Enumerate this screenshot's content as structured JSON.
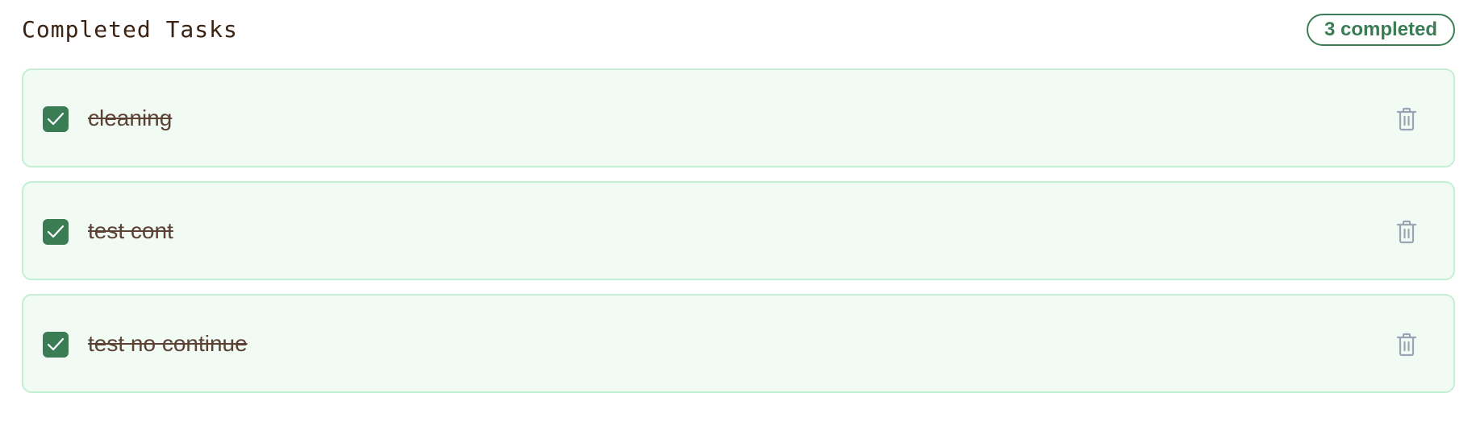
{
  "section": {
    "title": "Completed Tasks",
    "count_label": "3 completed"
  },
  "tasks": [
    {
      "label": "cleaning",
      "completed": true
    },
    {
      "label": "test cont",
      "completed": true
    },
    {
      "label": "test no continue",
      "completed": true
    }
  ],
  "colors": {
    "accent": "#3a7d55",
    "card_background": "#f1fbf4",
    "card_border": "#c3efd2",
    "title_text": "#3b2314",
    "task_text": "#5b4235",
    "delete_icon": "#9aa3b2"
  }
}
